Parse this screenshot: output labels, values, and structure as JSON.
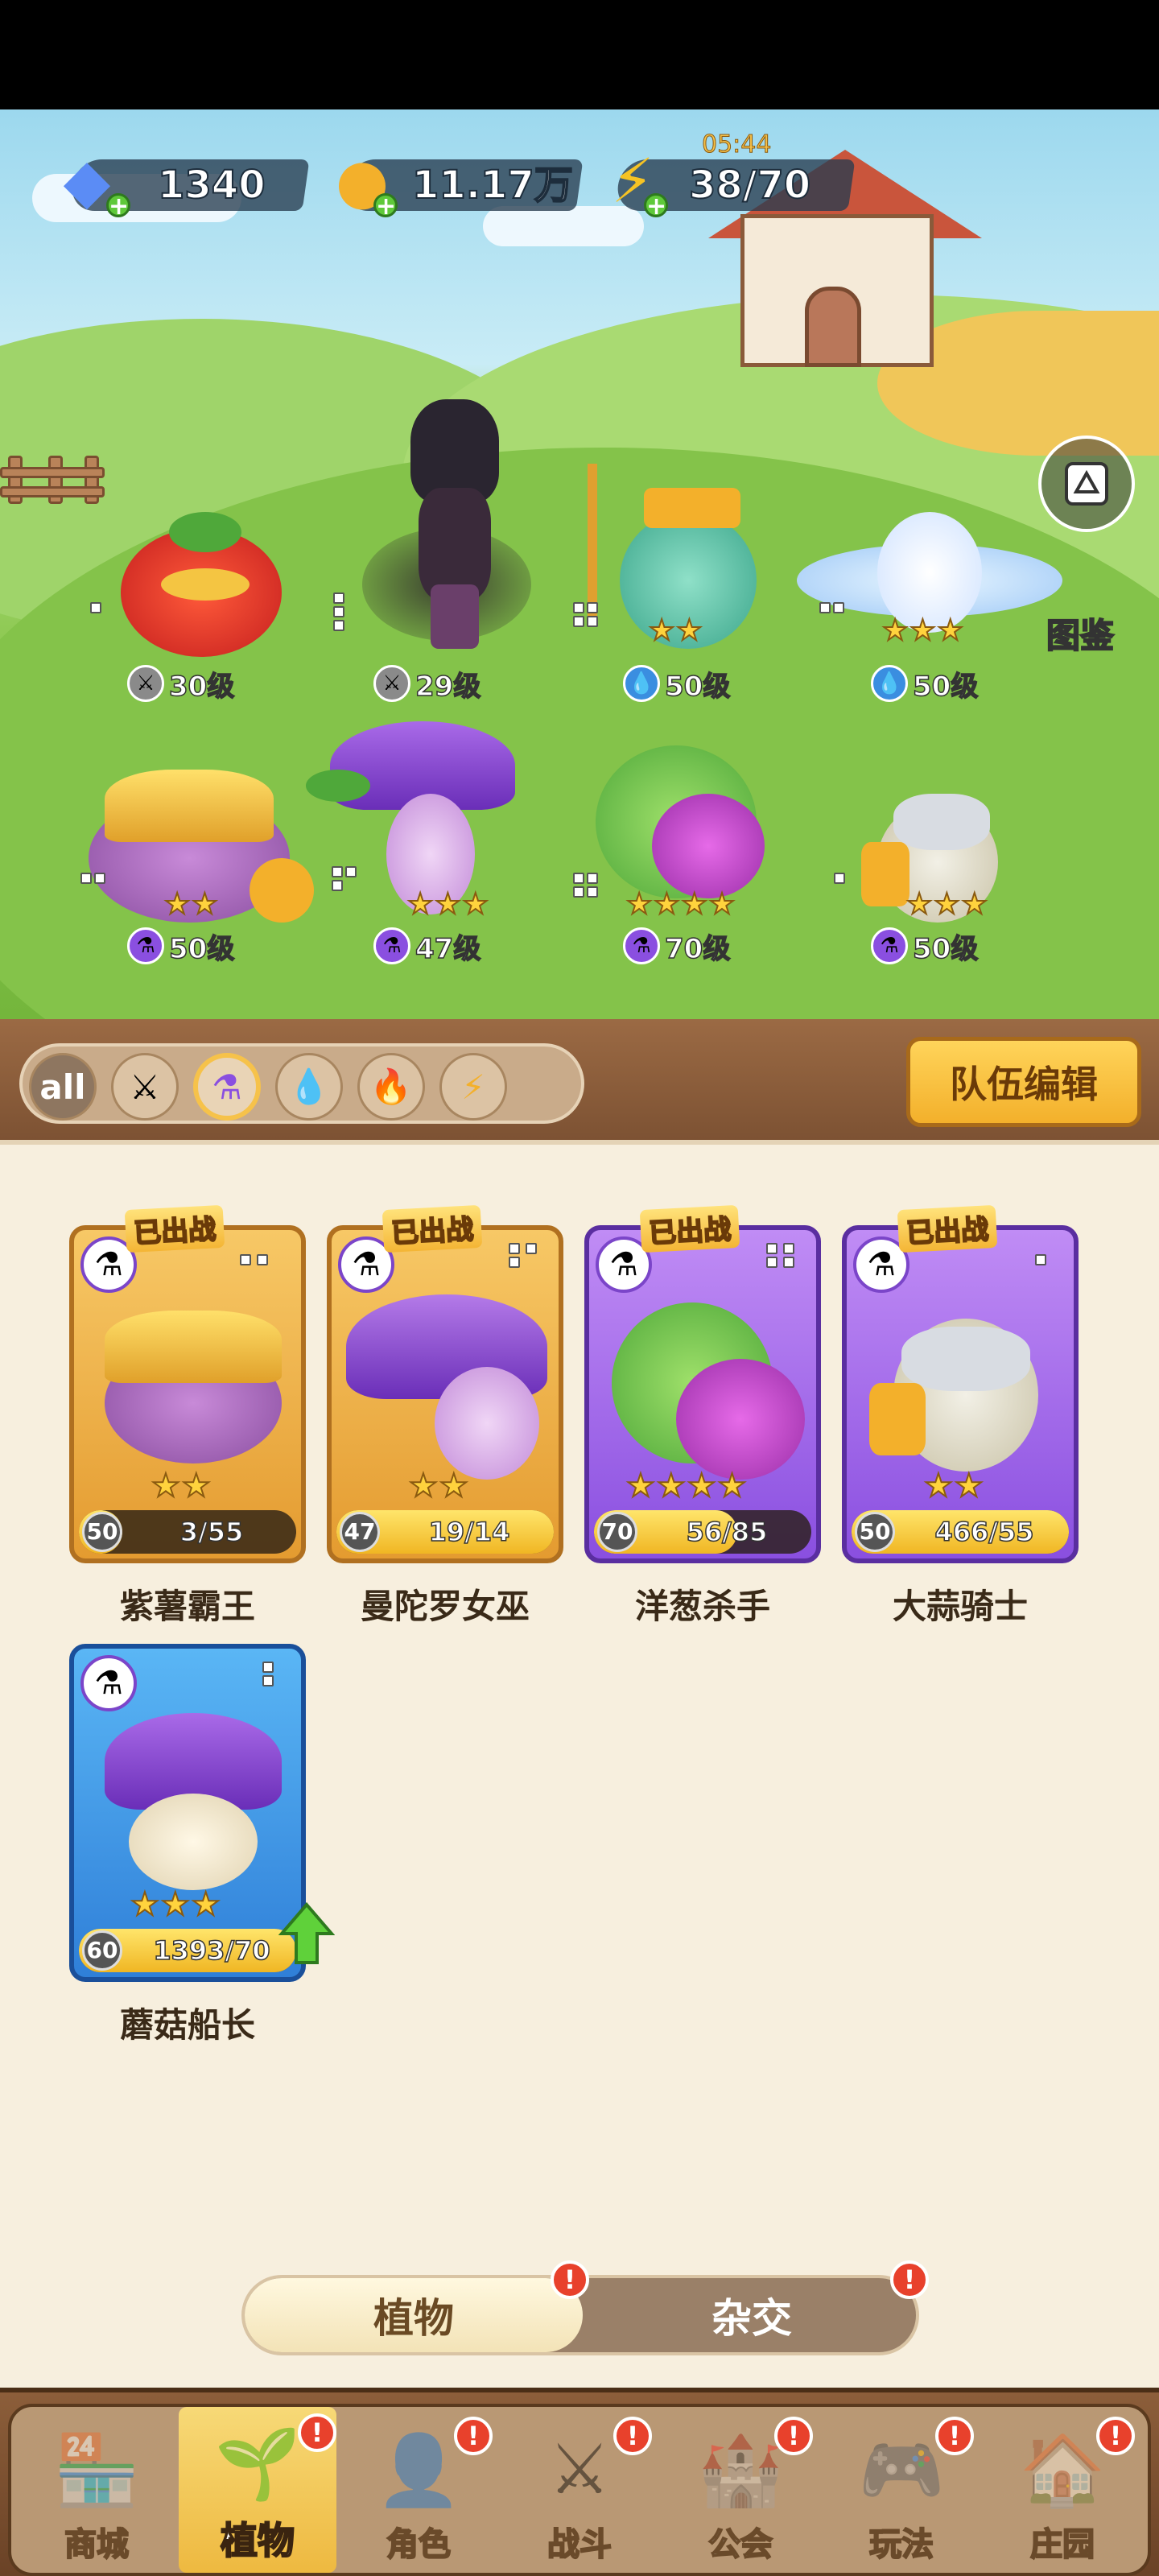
{
  "resources": {
    "gems": {
      "value": "1340",
      "icon": "diamond-icon"
    },
    "coins": {
      "value": "11.17万",
      "icon": "coin-icon"
    },
    "energy": {
      "value": "38/70",
      "icon": "lightning-icon",
      "timer": "05:44"
    }
  },
  "almanac": {
    "label": "图鉴"
  },
  "lineup": [
    {
      "name": "tomato-warrior",
      "type": "none",
      "level": "30级",
      "stars": 0
    },
    {
      "name": "shadow-cat-plant",
      "type": "sword",
      "level": "29级",
      "stars": 0
    },
    {
      "name": "trident-king",
      "type": "water",
      "level": "50级",
      "stars": 2
    },
    {
      "name": "crystal-flower",
      "type": "water",
      "level": "50级",
      "stars": 3
    },
    {
      "name": "purple-yam-king",
      "type": "potion",
      "level": "50级",
      "stars": 2
    },
    {
      "name": "datura-witch",
      "type": "potion",
      "level": "47级",
      "stars": 3
    },
    {
      "name": "onion-assassin",
      "type": "potion",
      "level": "70级",
      "stars": 4
    },
    {
      "name": "garlic-knight",
      "type": "potion",
      "level": "50级",
      "stars": 3
    }
  ],
  "filters": {
    "all_label": "all",
    "items": [
      "all",
      "sword",
      "potion",
      "water",
      "fire",
      "lightning"
    ],
    "active": "potion"
  },
  "team_edit_label": "队伍编辑",
  "cards": [
    {
      "name": "紫薯霸王",
      "level": "50",
      "progress": "3/55",
      "fill": 0.05,
      "stars": 2,
      "deployed": "已出战",
      "color": "gold"
    },
    {
      "name": "曼陀罗女巫",
      "level": "47",
      "progress": "19/14",
      "fill": 1.0,
      "stars": 2,
      "deployed": "已出战",
      "color": "gold"
    },
    {
      "name": "洋葱杀手",
      "level": "70",
      "progress": "56/85",
      "fill": 0.66,
      "stars": 4,
      "deployed": "已出战",
      "color": "purple"
    },
    {
      "name": "大蒜骑士",
      "level": "50",
      "progress": "466/55",
      "fill": 1.0,
      "stars": 2,
      "deployed": "已出战",
      "color": "purple"
    },
    {
      "name": "蘑菇船长",
      "level": "60",
      "progress": "1393/70",
      "fill": 1.0,
      "stars": 3,
      "deployed": "",
      "color": "blue"
    }
  ],
  "toggle": {
    "plants_label": "植物",
    "hybrid_label": "杂交",
    "badge": "!"
  },
  "nav": {
    "items": [
      {
        "label": "商城",
        "icon": "shop-icon",
        "badge": false
      },
      {
        "label": "植物",
        "icon": "plants-icon",
        "badge": true
      },
      {
        "label": "角色",
        "icon": "character-icon",
        "badge": true
      },
      {
        "label": "战斗",
        "icon": "battle-icon",
        "badge": true
      },
      {
        "label": "公会",
        "icon": "guild-icon",
        "badge": true
      },
      {
        "label": "玩法",
        "icon": "gameplay-icon",
        "badge": true
      },
      {
        "label": "庄园",
        "icon": "manor-icon",
        "badge": true
      }
    ],
    "active": "植物",
    "badge_text": "!"
  }
}
